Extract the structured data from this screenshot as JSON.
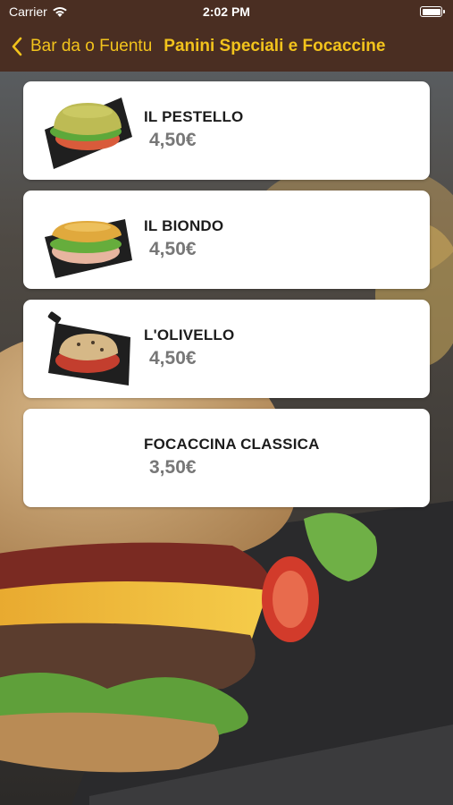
{
  "status_bar": {
    "carrier": "Carrier",
    "time": "2:02 PM",
    "wifi_icon": "wifi-icon",
    "battery_icon": "battery-icon",
    "battery_level": 1.0
  },
  "nav": {
    "back_label": "Bar da o Fuentu",
    "back_icon": "chevron-left-icon",
    "title": "Panini Speciali e Focaccine",
    "bar_color": "#4a2e22",
    "accent_color": "#f2c31c"
  },
  "products": [
    {
      "name": "IL PESTELLO",
      "price": "4,50€",
      "image": "sandwich-photo-green-bun"
    },
    {
      "name": "IL BIONDO",
      "price": "4,50€",
      "image": "sandwich-photo-golden-bun"
    },
    {
      "name": "L'OLIVELLO",
      "price": "4,50€",
      "image": "sandwich-photo-olive-bun"
    },
    {
      "name": "FOCACCINA CLASSICA",
      "price": "3,50€",
      "image": ""
    }
  ],
  "background_image": "burger-photo"
}
